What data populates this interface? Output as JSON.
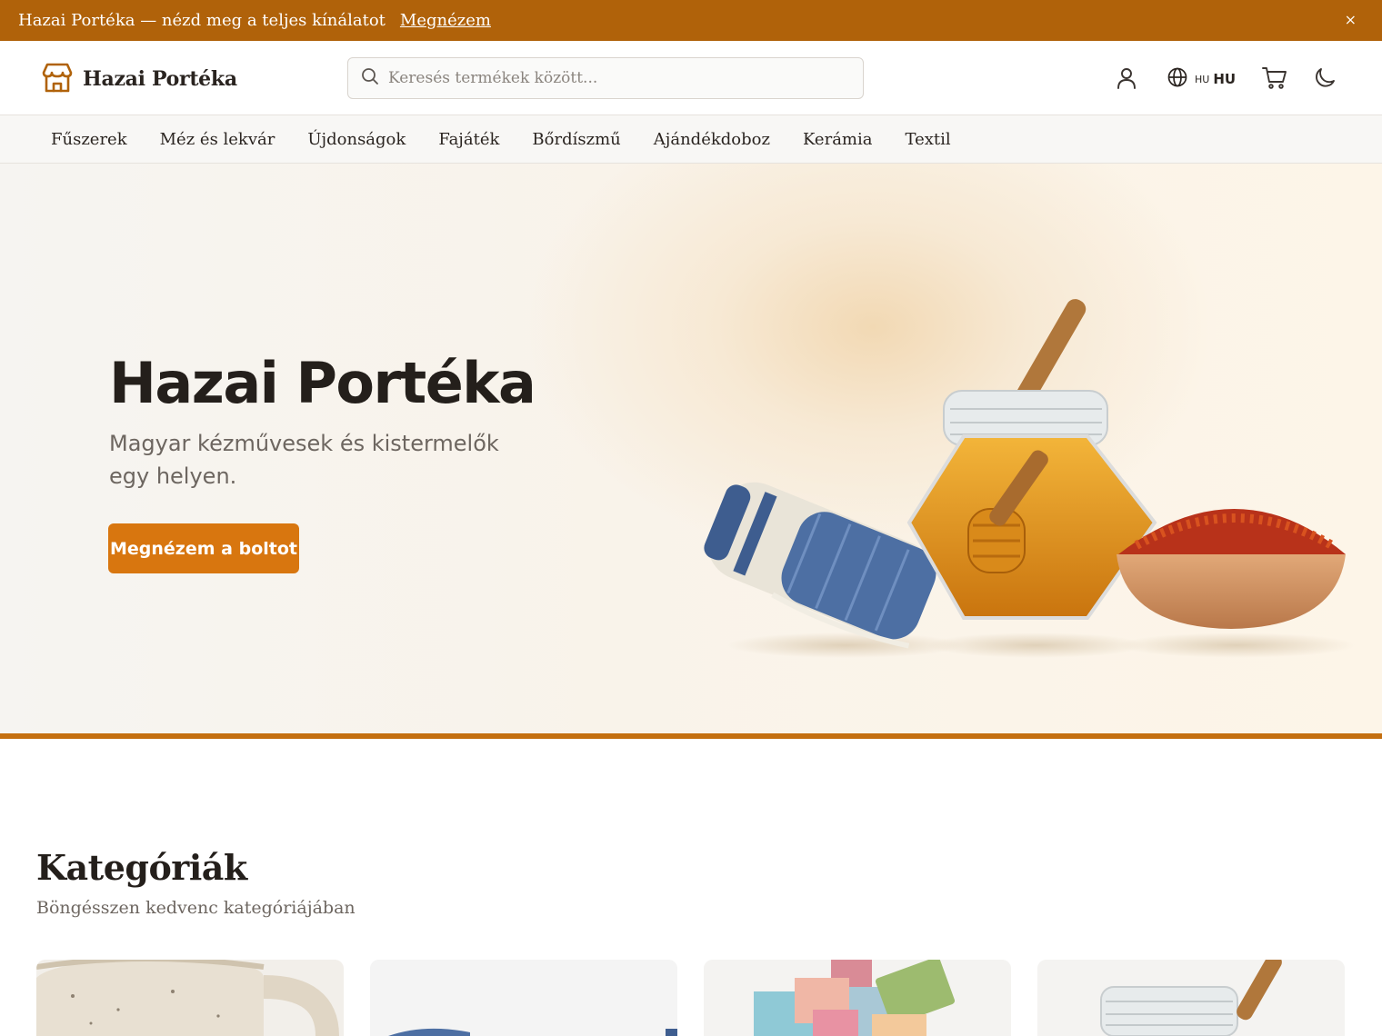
{
  "announcement": {
    "message": "Hazai Portéka — nézd meg a teljes kínálatot",
    "link_label": "Megnézem",
    "close_label": "×"
  },
  "header": {
    "logo_text": "Hazai Portéka",
    "search_placeholder": "Keresés termékek között...",
    "language_flag": "HU",
    "language_code": "HU",
    "icons": [
      "user-icon",
      "globe-icon",
      "cart-icon",
      "moon-icon"
    ]
  },
  "nav": {
    "items": [
      "Fűszerek",
      "Méz és lekvár",
      "Újdonságok",
      "Fajáték",
      "Bőrdíszmű",
      "Ajándékdoboz",
      "Kerámia",
      "Textil"
    ]
  },
  "hero": {
    "title": "Hazai Portéka",
    "subtitle": "Magyar kézművesek és kistermelők egy helyen.",
    "cta_label": "Megnézem a boltot"
  },
  "categories": {
    "title": "Kategóriák",
    "subtitle": "Böngésszen kedvenc kategóriájában"
  },
  "colors": {
    "brand": "#b0620a",
    "accent": "#d8760f"
  }
}
